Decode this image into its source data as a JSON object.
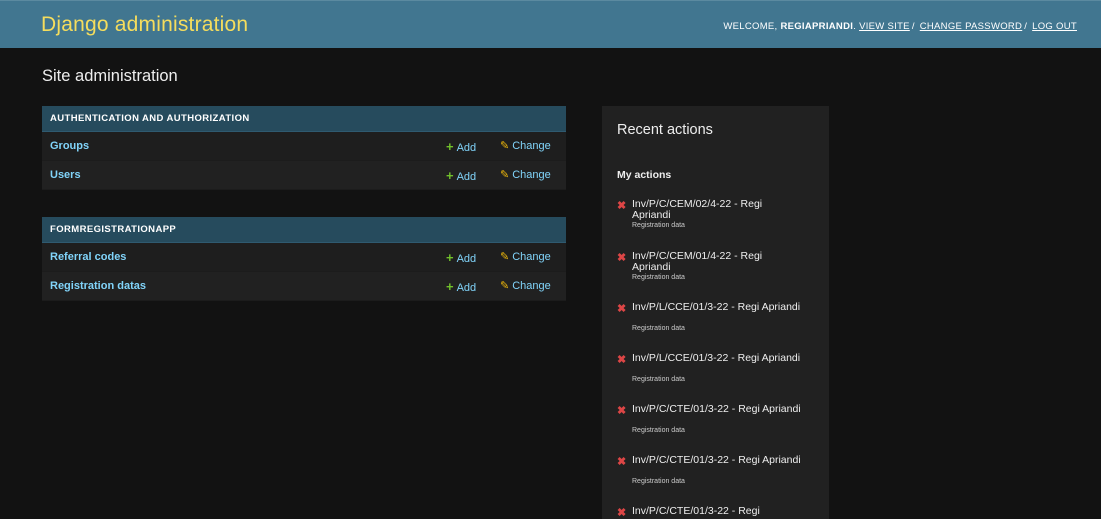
{
  "header": {
    "brand": "Django administration",
    "welcome": "WELCOME, ",
    "username": "REGIAPRIANDI",
    "view_site": "VIEW SITE",
    "change_password": "CHANGE PASSWORD",
    "log_out": "LOG OUT"
  },
  "page_title": "Site administration",
  "modules": [
    {
      "caption": "AUTHENTICATION AND AUTHORIZATION",
      "rows": [
        {
          "model": "Groups",
          "add": "Add",
          "change": "Change"
        },
        {
          "model": "Users",
          "add": "Add",
          "change": "Change"
        }
      ]
    },
    {
      "caption": "FORMREGISTRATIONAPP",
      "rows": [
        {
          "model": "Referral codes",
          "add": "Add",
          "change": "Change"
        },
        {
          "model": "Registration datas",
          "add": "Add",
          "change": "Change"
        }
      ]
    }
  ],
  "recent": {
    "title": "Recent actions",
    "my_actions": "My actions",
    "items": [
      {
        "text": "Inv/P/C/CEM/02/4-22 - Regi Apriandi",
        "type": "Registration data"
      },
      {
        "text": "Inv/P/C/CEM/01/4-22 - Regi Apriandi",
        "type": "Registration data"
      },
      {
        "text": "Inv/P/L/CCE/01/3-22 - Regi Apriandi",
        "type": "Registration data"
      },
      {
        "text": "Inv/P/L/CCE/01/3-22 - Regi Apriandi",
        "type": "Registration data"
      },
      {
        "text": "Inv/P/C/CTE/01/3-22 - Regi Apriandi",
        "type": "Registration data"
      },
      {
        "text": "Inv/P/C/CTE/01/3-22 - Regi Apriandi",
        "type": "Registration data"
      },
      {
        "text": "Inv/P/C/CTE/01/3-22 - Regi",
        "type": ""
      }
    ]
  },
  "colors": {
    "header_bg": "#417690",
    "brand": "#f5dd5d",
    "caption_bg": "#264b5d",
    "link": "#81d4fa",
    "add_icon": "#70bf2b",
    "change_icon": "#efb80b",
    "delete_icon": "#dd4646"
  },
  "icons": {
    "add": "plus-icon",
    "change": "pencil-icon",
    "delete": "delete-x-icon"
  }
}
